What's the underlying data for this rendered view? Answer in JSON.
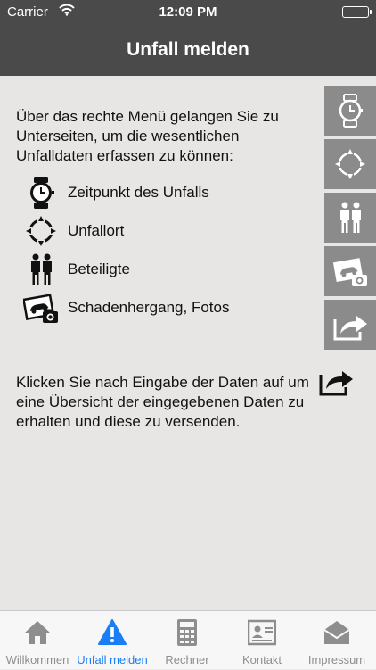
{
  "status_bar": {
    "carrier": "Carrier",
    "time": "12:09 PM",
    "battery_level": 1.0
  },
  "nav": {
    "title": "Unfall melden"
  },
  "content": {
    "intro": "Über das rechte Menü gelangen Sie zu Unterseiten, um die wesentlichen Unfalldaten erfassen zu können:",
    "items": [
      {
        "label": "Zeitpunkt des Unfalls",
        "icon": "watch-icon"
      },
      {
        "label": "Unfallort",
        "icon": "location-target-icon"
      },
      {
        "label": "Beteiligte",
        "icon": "people-icon"
      },
      {
        "label": "Schadenhergang, Fotos",
        "icon": "photo-camera-icon"
      }
    ],
    "outro": "Klicken Sie nach Eingabe der Daten auf um eine Übersicht der eingegebenen Daten zu erhalten und diese zu versenden.",
    "outro_icon": "share-icon"
  },
  "side_menu": [
    {
      "icon": "watch-icon"
    },
    {
      "icon": "location-target-icon"
    },
    {
      "icon": "people-icon"
    },
    {
      "icon": "photo-camera-icon"
    },
    {
      "icon": "share-icon"
    }
  ],
  "tabs": [
    {
      "label": "Willkommen",
      "icon": "home-icon",
      "active": false
    },
    {
      "label": "Unfall melden",
      "icon": "warning-icon",
      "active": true
    },
    {
      "label": "Rechner",
      "icon": "calculator-icon",
      "active": false
    },
    {
      "label": "Kontakt",
      "icon": "contact-card-icon",
      "active": false
    },
    {
      "label": "Impressum",
      "icon": "mail-icon",
      "active": false
    }
  ],
  "colors": {
    "bar_bg": "#4a4a4a",
    "content_bg": "#e8e6e5",
    "side_button_bg": "#8b8b8b",
    "tab_active": "#1a7ef7",
    "tab_inactive": "#8e8e8e"
  }
}
